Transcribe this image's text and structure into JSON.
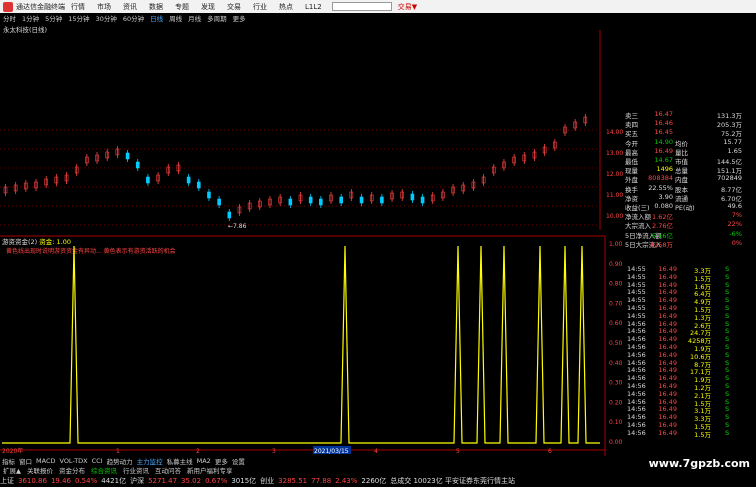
{
  "window": {
    "title": "通达信金融终端",
    "menu": [
      "行情",
      "市场",
      "资讯",
      "数据",
      "专题",
      "发现",
      "交易",
      "行业",
      "热点",
      "L1L2"
    ],
    "account": "交易▼"
  },
  "toolbar": {
    "periods": [
      "分时",
      "1分钟",
      "5分钟",
      "15分钟",
      "30分钟",
      "60分钟",
      "日线",
      "周线",
      "月线",
      "多周期",
      "更多"
    ],
    "active": "日线"
  },
  "stock_label": "永太科技(日线)",
  "price_chart": {
    "y_ticks": [
      "14.00",
      "13.00",
      "12.00",
      "11.00",
      "10.00",
      "9.00"
    ],
    "low_label": "7.86"
  },
  "indicator": {
    "title": "游资资金(2)",
    "param_label": "资金: 1.00",
    "description": "黄色线出现时说明游资资金有异动... 黄色表示有游资活跃的机会",
    "y_ticks": [
      "1.00",
      "0.90",
      "0.80",
      "0.70",
      "0.60",
      "0.50",
      "0.40",
      "0.30",
      "0.20",
      "0.10",
      "0.00"
    ],
    "x_labels": [
      "2020年",
      "1",
      "2",
      "3",
      "2021/03/15",
      "4",
      "5",
      "6"
    ],
    "date_highlight": "2021/03/15"
  },
  "quote_panel": {
    "rows": [
      {
        "lbl": "卖三",
        "v1": "16.47",
        "l2": "",
        "v2": "131.3万"
      },
      {
        "lbl": "卖四",
        "v1": "16.46",
        "l2": "",
        "v2": "205.3万"
      },
      {
        "lbl": "买五",
        "v1": "16.45",
        "l2": "",
        "v2": "75.2万"
      },
      {
        "lbl": "今开",
        "v1": "14.90",
        "l2": "均价",
        "v2": "15.77"
      },
      {
        "lbl": "最高",
        "v1": "16.49",
        "l2": "量比",
        "v2": "1.65"
      },
      {
        "lbl": "最低",
        "v1": "14.67",
        "l2": "市值",
        "v2": "144.5亿"
      },
      {
        "lbl": "现量",
        "v1": "1496",
        "l2": "总量",
        "v2": "151.1万"
      },
      {
        "lbl": "外盘",
        "v1": "808384",
        "l2": "内盘",
        "v2": "702849"
      },
      {
        "lbl": "换手",
        "v1": "22.55%",
        "l2": "股本",
        "v2": "8.77亿"
      },
      {
        "lbl": "净资",
        "v1": "3.90",
        "l2": "流通",
        "v2": "6.70亿"
      },
      {
        "lbl": "收益(三)",
        "v1": "0.080",
        "l2": "PE(动)",
        "v2": "49.6"
      },
      {
        "lbl": "净流入额",
        "v1": "1.62亿",
        "l2": "",
        "v2": "7%"
      },
      {
        "lbl": "大宗流入",
        "v1": "2.76亿",
        "l2": "",
        "v2": "22%"
      },
      {
        "lbl": "5日净流入额",
        "v1": "-5.16亿",
        "l2": "",
        "v2": "-6%"
      },
      {
        "lbl": "5日大宗流入",
        "v1": "4258万",
        "l2": "",
        "v2": "0%"
      }
    ],
    "trades": [
      {
        "t": "14:55",
        "p": "16.49",
        "vol": "3.3万",
        "bs": "S"
      },
      {
        "t": "14:55",
        "p": "16.49",
        "vol": "1.5万",
        "bs": "S"
      },
      {
        "t": "14:55",
        "p": "16.49",
        "vol": "1.6万",
        "bs": "S"
      },
      {
        "t": "14:55",
        "p": "16.49",
        "vol": "6.4万",
        "bs": "S"
      },
      {
        "t": "14:55",
        "p": "16.49",
        "vol": "4.9万",
        "bs": "S"
      },
      {
        "t": "14:55",
        "p": "16.49",
        "vol": "1.5万",
        "bs": "S"
      },
      {
        "t": "14:55",
        "p": "16.49",
        "vol": "1.3万",
        "bs": "S"
      },
      {
        "t": "14:56",
        "p": "16.49",
        "vol": "2.6万",
        "bs": "S"
      },
      {
        "t": "14:56",
        "p": "16.49",
        "vol": "24.7万",
        "bs": "S"
      },
      {
        "t": "14:56",
        "p": "16.49",
        "vol": "4258万",
        "bs": "S"
      },
      {
        "t": "14:56",
        "p": "16.49",
        "vol": "1.9万",
        "bs": "S"
      },
      {
        "t": "14:56",
        "p": "16.49",
        "vol": "10.6万",
        "bs": "S"
      },
      {
        "t": "14:56",
        "p": "16.49",
        "vol": "8.7万",
        "bs": "S"
      },
      {
        "t": "14:56",
        "p": "16.49",
        "vol": "17.1万",
        "bs": "S"
      },
      {
        "t": "14:56",
        "p": "16.49",
        "vol": "1.9万",
        "bs": "S"
      },
      {
        "t": "14:56",
        "p": "16.49",
        "vol": "1.2万",
        "bs": "S"
      },
      {
        "t": "14:56",
        "p": "16.49",
        "vol": "2.1万",
        "bs": "S"
      },
      {
        "t": "14:56",
        "p": "16.49",
        "vol": "1.5万",
        "bs": "S"
      },
      {
        "t": "14:56",
        "p": "16.49",
        "vol": "3.1万",
        "bs": "S"
      },
      {
        "t": "14:56",
        "p": "16.49",
        "vol": "3.3万",
        "bs": "S"
      },
      {
        "t": "14:56",
        "p": "16.49",
        "vol": "1.5万",
        "bs": "S"
      },
      {
        "t": "14:56",
        "p": "16.49",
        "vol": "1.5万",
        "bs": "S"
      }
    ]
  },
  "bottom_tabs": [
    "指标",
    "窗口",
    "MACD",
    "VOL-TDX",
    "CCI",
    "趋势动力",
    "主力监控",
    "私募主线",
    "MA2",
    "更多",
    "设置"
  ],
  "bottom_tab_selected": "主力监控",
  "nav_tabs": [
    "扩展▲",
    "关联报价",
    "资金分布",
    "综合资讯",
    "行业资讯",
    "互动问答",
    "新用户福利专享"
  ],
  "status": [
    {
      "label": "上证",
      "value": "3610.86",
      "chg": "19.46",
      "pct": "0.54%",
      "amt": "4421亿"
    },
    {
      "label": "沪深",
      "value": "5271.47",
      "chg": "35.02",
      "pct": "0.67%",
      "amt": "3015亿"
    },
    {
      "label": "创业",
      "value": "3285.51",
      "chg": "77.88",
      "pct": "2.43%",
      "amt": "2260亿"
    }
  ],
  "status_extra": "总成交 10023亿 平安证券东莞行情主站",
  "watermark": "www.7gpzb.com",
  "colors": {
    "up": "#ff4444",
    "down": "#00cccc",
    "indicator": "#ffff00",
    "grid": "#880000"
  }
}
